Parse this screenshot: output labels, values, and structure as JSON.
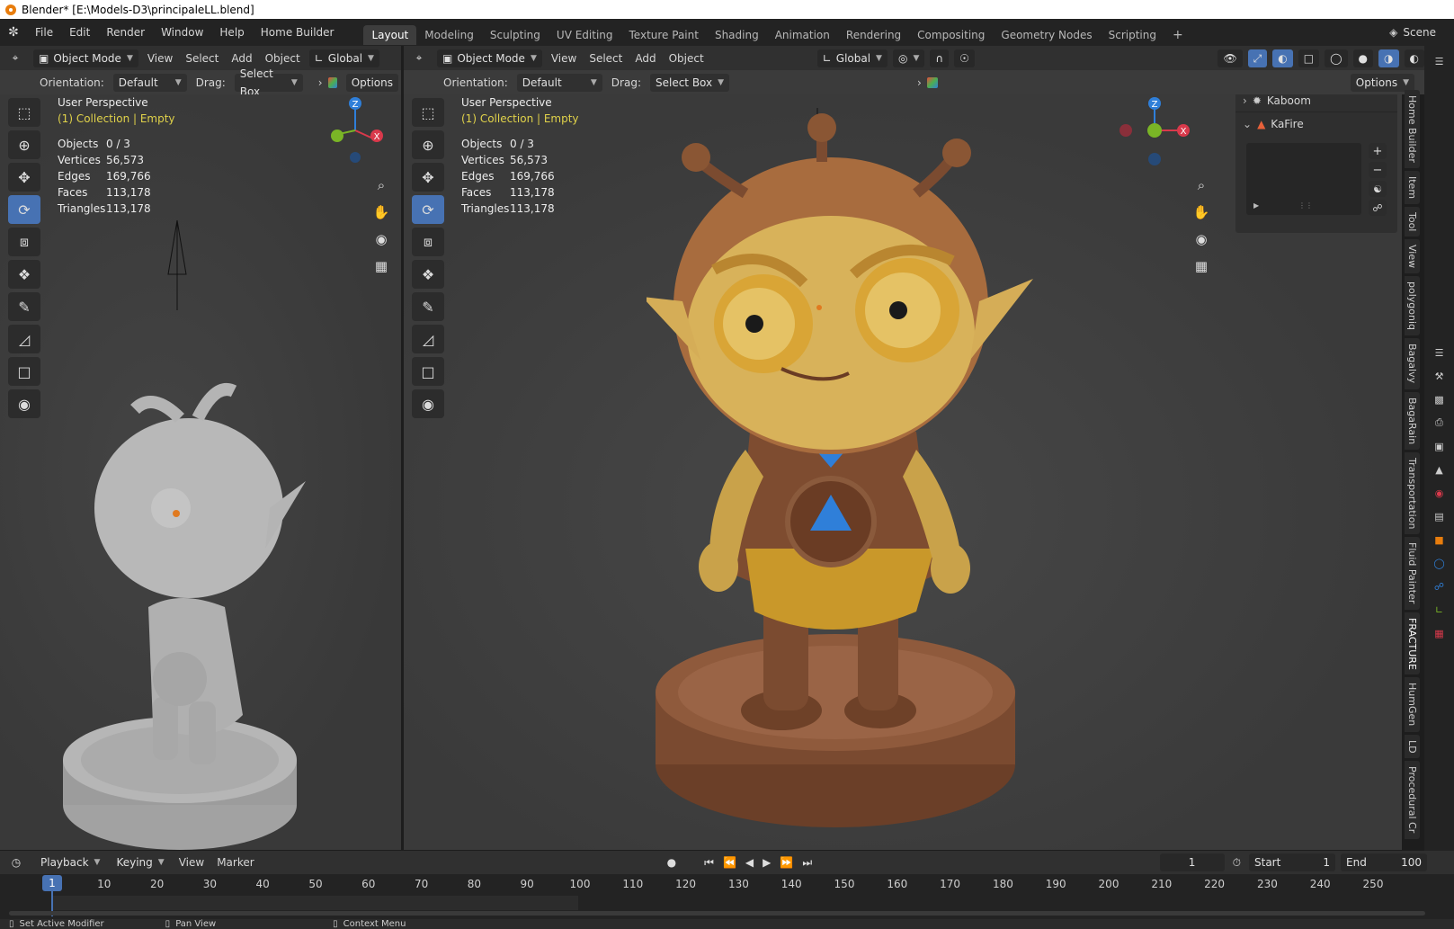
{
  "window": {
    "title": "Blender* [E:\\Models-D3\\principaleLL.blend]"
  },
  "menu": [
    "File",
    "Edit",
    "Render",
    "Window",
    "Help",
    "Home Builder"
  ],
  "workspaces": [
    "Layout",
    "Modeling",
    "Sculpting",
    "UV Editing",
    "Texture Paint",
    "Shading",
    "Animation",
    "Rendering",
    "Compositing",
    "Geometry Nodes",
    "Scripting"
  ],
  "active_workspace": "Layout",
  "scene_label": "Scene",
  "viewport_left": {
    "mode": "Object Mode",
    "menus": [
      "View",
      "Select",
      "Add",
      "Object"
    ],
    "transform": "Global",
    "orientation_label": "Orientation:",
    "orientation_value": "Default",
    "drag_label": "Drag:",
    "drag_value": "Select Box",
    "options": "Options",
    "perspective": "User Perspective",
    "collection": "(1) Collection | Empty",
    "stats": [
      {
        "k": "Objects",
        "v": "0 / 3"
      },
      {
        "k": "Vertices",
        "v": "56,573"
      },
      {
        "k": "Edges",
        "v": "169,766"
      },
      {
        "k": "Faces",
        "v": "113,178"
      },
      {
        "k": "Triangles",
        "v": "113,178"
      }
    ]
  },
  "viewport_right": {
    "mode": "Object Mode",
    "menus": [
      "View",
      "Select",
      "Add",
      "Object"
    ],
    "transform": "Global",
    "orientation_label": "Orientation:",
    "orientation_value": "Default",
    "drag_label": "Drag:",
    "drag_value": "Select Box",
    "options": "Options",
    "perspective": "User Perspective",
    "collection": "(1) Collection | Empty",
    "stats": [
      {
        "k": "Objects",
        "v": "0 / 3"
      },
      {
        "k": "Vertices",
        "v": "56,573"
      },
      {
        "k": "Edges",
        "v": "169,766"
      },
      {
        "k": "Faces",
        "v": "113,178"
      },
      {
        "k": "Triangles",
        "v": "113,178"
      }
    ]
  },
  "gizmo": {
    "z": "Z",
    "x": "X",
    "colors": {
      "x": "#d9394b",
      "y": "#7ab526",
      "z": "#2f7fd9"
    }
  },
  "n_panel": {
    "items": [
      {
        "label": "Kaboom",
        "expanded": false
      },
      {
        "label": "KaFire",
        "expanded": true
      }
    ]
  },
  "side_tabs": [
    "Home Builder",
    "Item",
    "Tool",
    "View",
    "polygoniq",
    "Bagalvy",
    "BagaRain",
    "Transportation",
    "Fluid Painter",
    "FRACTURE",
    "HumGen",
    "LD",
    "Procedural Cr"
  ],
  "active_side_tab": "FRACTURE",
  "timeline": {
    "menus": [
      "Playback",
      "Keying",
      "View",
      "Marker"
    ],
    "current_frame": "1",
    "start_label": "Start",
    "start": "1",
    "end_label": "End",
    "end": "100",
    "ticks": [
      "10",
      "20",
      "30",
      "40",
      "50",
      "60",
      "70",
      "80",
      "90",
      "100",
      "110",
      "120",
      "130",
      "140",
      "150",
      "160",
      "170",
      "180",
      "190",
      "200",
      "210",
      "220",
      "230",
      "240",
      "250"
    ]
  },
  "status": [
    "Set Active Modifier",
    "Pan View",
    "Context Menu"
  ],
  "colors": {
    "accent": "#4772b3",
    "collection_text": "#e0d24a",
    "figure_left": "#a5a5a5",
    "figure_skin": "#d8b25a",
    "figure_base": "#8a5a3c"
  }
}
